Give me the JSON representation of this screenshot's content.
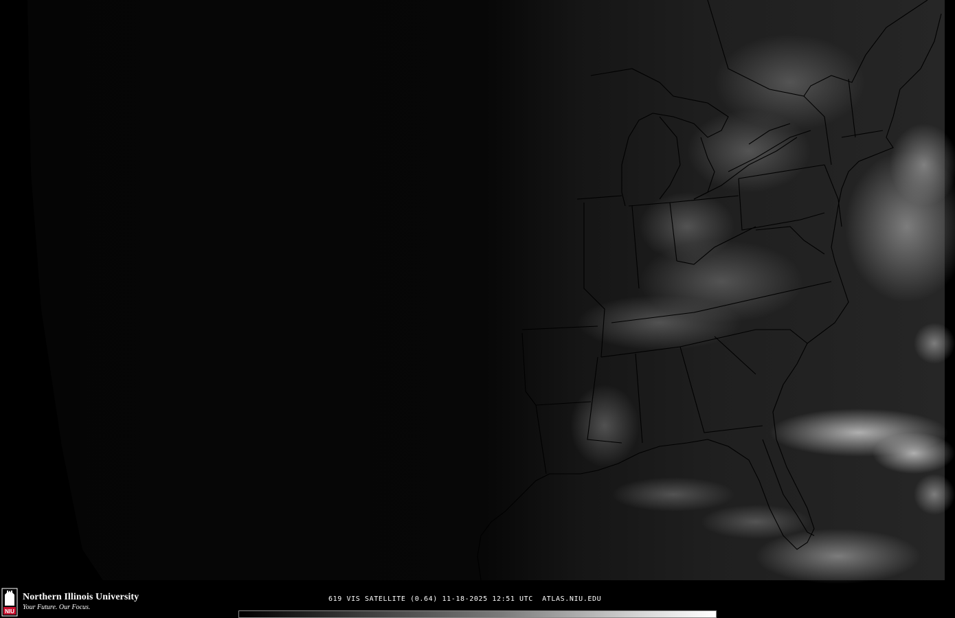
{
  "branding": {
    "university_name": "Northern Illinois University",
    "tagline": "Your Future. Our Focus.",
    "logo_text": "NIU"
  },
  "caption": {
    "text": "619 VIS SATELLITE (0.64) 11-18-2025 12:51 UTC  ATLAS.NIU.EDU"
  },
  "colors": {
    "background": "#000000",
    "coast_lines": "#000000",
    "text": "#ffffff",
    "logo_red": "#c8102e"
  },
  "map": {
    "region": "Eastern United States",
    "product": "Visible satellite imagery",
    "icon": "satellite-map"
  },
  "colorbar": {
    "min_color": "#000000",
    "max_color": "#ffffff"
  }
}
